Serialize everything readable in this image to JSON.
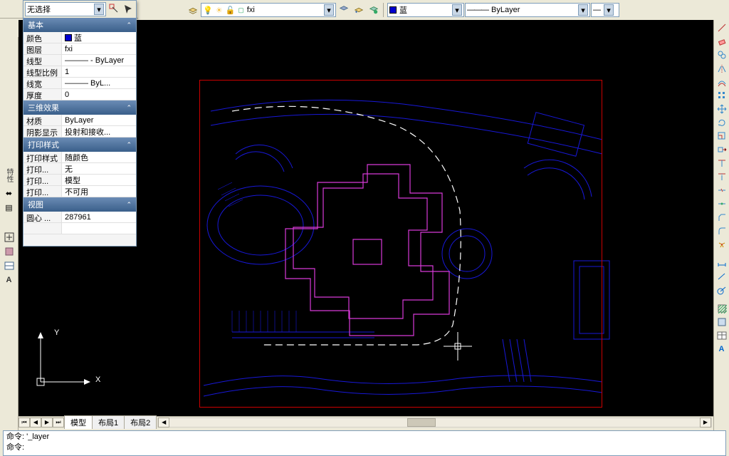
{
  "selection_combo": "无选择",
  "top_toolbar": {
    "layer_combo_text": "fxi",
    "color_combo_text": "蓝",
    "linetype_combo_text": "ByLayer"
  },
  "properties": {
    "sections": {
      "basic": {
        "title": "基本",
        "rows": [
          {
            "k": "颜色",
            "v": "蓝",
            "sw": "#0000d0"
          },
          {
            "k": "图层",
            "v": "fxi"
          },
          {
            "k": "线型",
            "v": "——— - ByLayer"
          },
          {
            "k": "线型比例",
            "v": "1"
          },
          {
            "k": "线宽",
            "v": "——— ByL..."
          },
          {
            "k": "厚度",
            "v": "0"
          }
        ]
      },
      "threeD": {
        "title": "三维效果",
        "rows": [
          {
            "k": "材质",
            "v": "ByLayer"
          },
          {
            "k": "阴影显示",
            "v": "投射和接收..."
          }
        ]
      },
      "print": {
        "title": "打印样式",
        "rows": [
          {
            "k": "打印样式",
            "v": "随颜色"
          },
          {
            "k": "打印...",
            "v": "无"
          },
          {
            "k": "打印...",
            "v": "模型"
          },
          {
            "k": "打印...",
            "v": "不可用"
          }
        ]
      },
      "view": {
        "title": "视图",
        "rows": [
          {
            "k": "圆心 ...",
            "v": "287961"
          }
        ]
      }
    }
  },
  "tabs": {
    "model": "模型",
    "layout1": "布局1",
    "layout2": "布局2"
  },
  "ucs": {
    "x": "X",
    "y": "Y"
  },
  "command": {
    "line1": "命令: '_layer",
    "line2": "命令:"
  },
  "leftstrip_label": "特性",
  "colors": {
    "blue": "#0000d0"
  }
}
